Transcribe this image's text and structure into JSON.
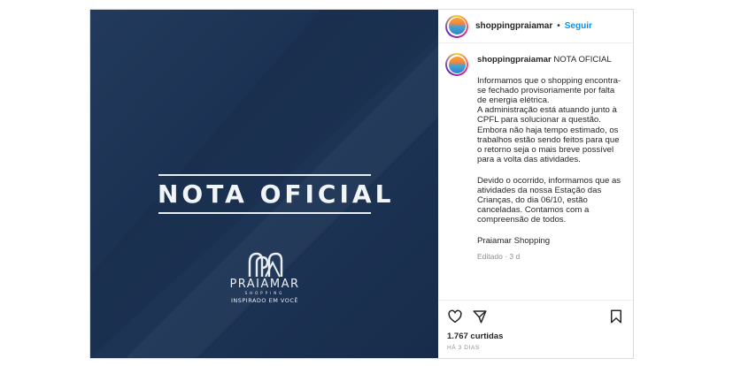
{
  "post": {
    "image": {
      "headline": "NOTA OFICIAL",
      "brand_name": "PRAIAMAR",
      "brand_sub": "SHOPPING",
      "brand_tagline": "INSPIRADO EM VOCÊ"
    },
    "header": {
      "username": "shoppingpraiamar",
      "separator": "•",
      "follow_label": "Seguir"
    },
    "caption": {
      "username": "shoppingpraiamar",
      "title": "NOTA OFICIAL",
      "paragraph1": "Informamos que o shopping encontra-se fechado provisoriamente por falta de energia elétrica.",
      "paragraph2": "A administração está atuando junto à CPFL para solucionar a questão. Embora não haja tempo estimado, os trabalhos estão sendo feitos para que o retorno seja o mais breve possível para a volta das atividades.",
      "paragraph3": "Devido o ocorrido, informamos que as atividades da nossa Estação das Crianças, do dia 06/10, estão canceladas. Contamos com a compreensão de todos.",
      "signature": "Praiamar Shopping",
      "meta": "Editado · 3 d"
    },
    "actions": {
      "like_icon": "heart-icon",
      "share_icon": "paper-plane-icon",
      "save_icon": "bookmark-icon"
    },
    "likes": "1.767 curtidas",
    "timestamp": "HÁ 3 DIAS"
  },
  "colors": {
    "image_background": "#1c3253",
    "follow": "#0095f6",
    "text": "#262626",
    "muted": "#8e8e8e"
  }
}
